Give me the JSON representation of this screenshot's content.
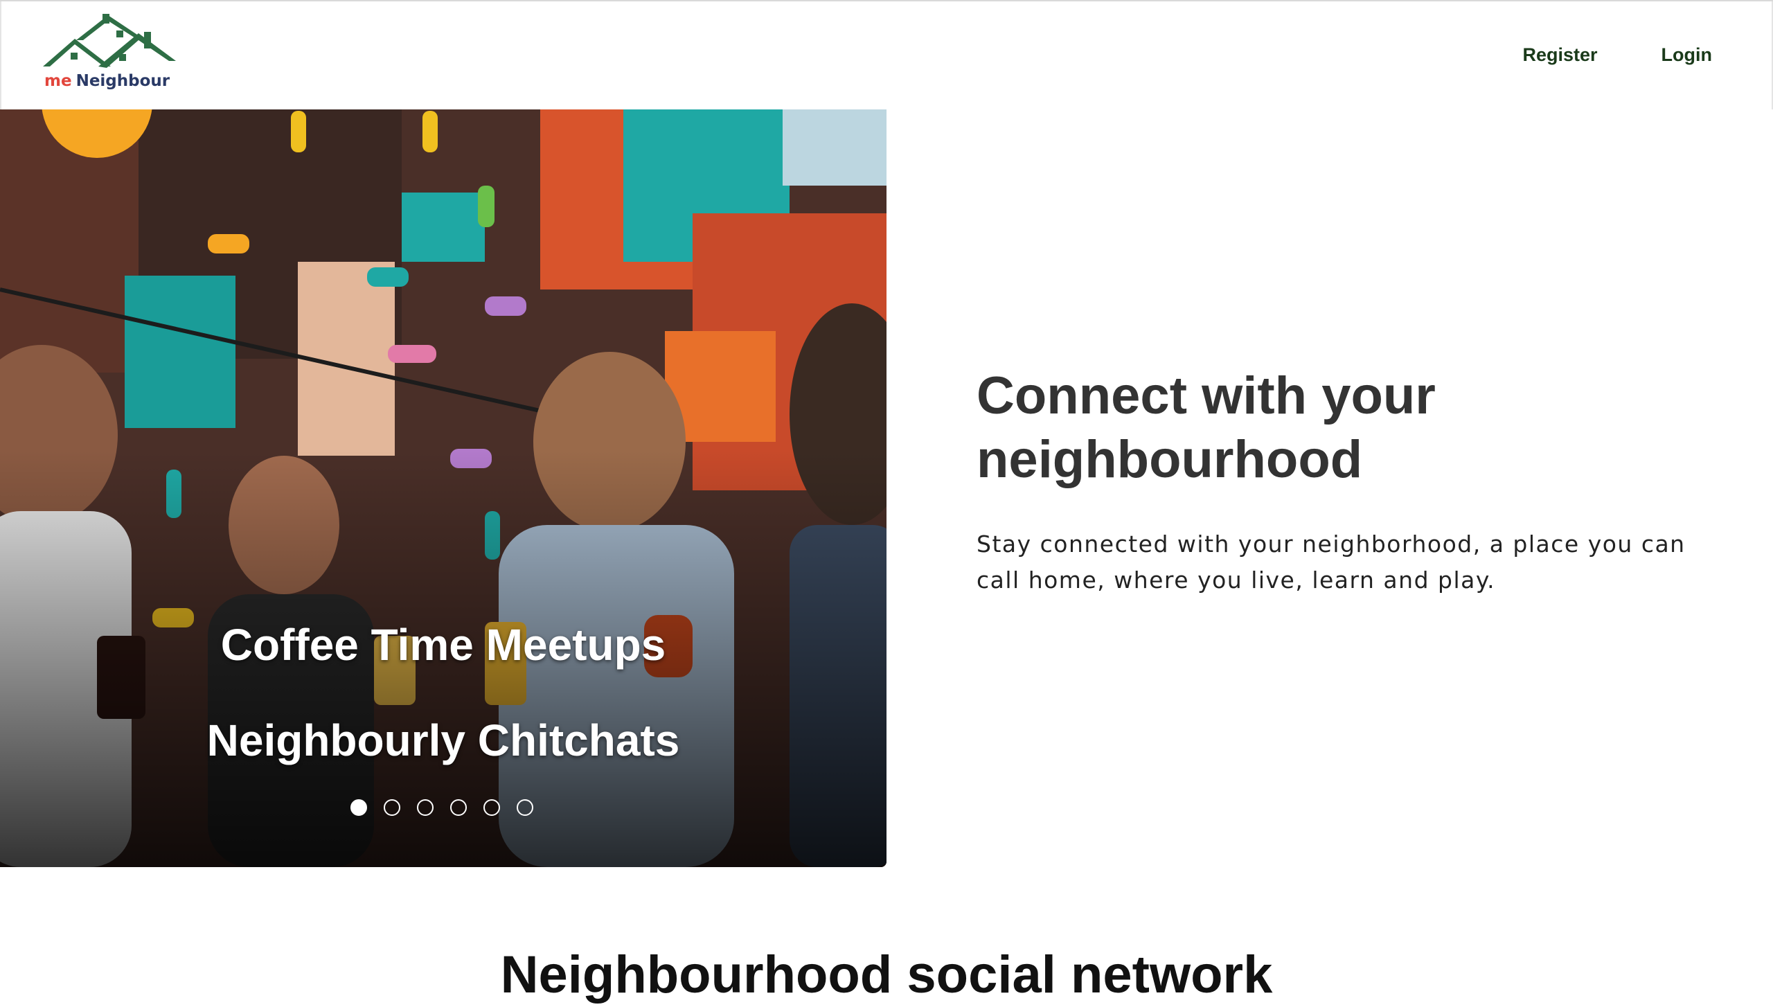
{
  "brand": {
    "logo_prefix": "me",
    "logo_name": "Neighbour",
    "colors": {
      "roof": "#2e6e45",
      "prefix": "#e2463c",
      "name": "#2a3a66"
    }
  },
  "nav": {
    "register_label": "Register",
    "login_label": "Login"
  },
  "carousel": {
    "captions": [
      "Coffee Time Meetups",
      "Neighbourly Chitchats"
    ],
    "slide_count": 6,
    "active_slide": 1
  },
  "intro": {
    "title": "Connect with your neighbourhood",
    "text": "Stay connected with your neighborhood, a place you can call home, where you live, learn and play."
  },
  "section": {
    "title": "Neighbourhood social network"
  }
}
